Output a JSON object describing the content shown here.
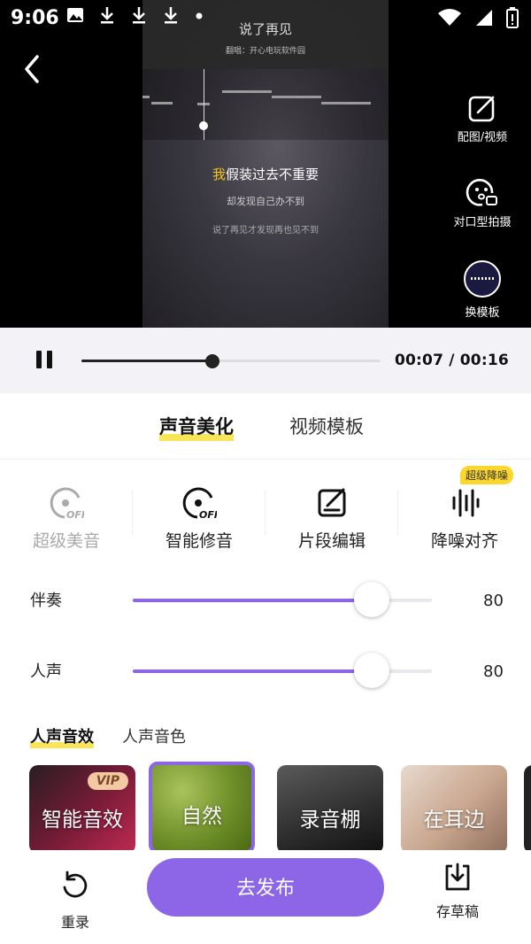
{
  "status_bar": {
    "time": "9:06",
    "left_icons": [
      "image-icon",
      "download-icon",
      "download-icon",
      "download-icon",
      "dot-icon"
    ],
    "right_icons": [
      "wifi-icon",
      "signal-icon",
      "battery-icon"
    ]
  },
  "video": {
    "song_title": "说了再见",
    "song_subtitle": "翻唱：开心电玩软件园",
    "lyric_current_highlight": "我",
    "lyric_current_rest": "假装过去不重要",
    "lyric_next": "却发现自己办不到",
    "lyric_after": "说了再见才发现再也见不到"
  },
  "side_tools": [
    {
      "label": "配图/视频",
      "icon": "edit-image-icon"
    },
    {
      "label": "对口型拍摄",
      "icon": "lipsync-camera-icon"
    },
    {
      "label": "换模板",
      "icon": "template-thumbnail-icon"
    }
  ],
  "playback": {
    "time_display": "00:07 / 00:16",
    "progress": 0.4375
  },
  "tabs": [
    {
      "label": "声音美化",
      "active": true
    },
    {
      "label": "视频模板",
      "active": false
    }
  ],
  "tools": [
    {
      "label": "超级美音",
      "icon": "disc-off-icon",
      "disabled": true
    },
    {
      "label": "智能修音",
      "icon": "disc-off-icon",
      "disabled": false
    },
    {
      "label": "片段编辑",
      "icon": "edit-icon",
      "disabled": false
    },
    {
      "label": "降噪对齐",
      "icon": "waveform-icon",
      "disabled": false,
      "badge": "超级降噪"
    }
  ],
  "sliders": [
    {
      "label": "伴奏",
      "value": "80",
      "level": 0.8
    },
    {
      "label": "人声",
      "value": "80",
      "level": 0.8
    }
  ],
  "effect_tabs": [
    {
      "label": "人声音效",
      "active": true
    },
    {
      "label": "人声音色",
      "active": false
    }
  ],
  "effect_cards": [
    {
      "label": "智能音效",
      "badge": "VIP",
      "selected": false
    },
    {
      "label": "自然",
      "selected": true
    },
    {
      "label": "录音棚",
      "selected": false
    },
    {
      "label": "在耳边",
      "selected": false
    }
  ],
  "bottom": {
    "redo_label": "重录",
    "publish_label": "去发布",
    "draft_label": "存草稿"
  },
  "colors": {
    "accent": "#8c66e6",
    "highlight": "#f9e55a",
    "badge": "#fbd72c"
  }
}
